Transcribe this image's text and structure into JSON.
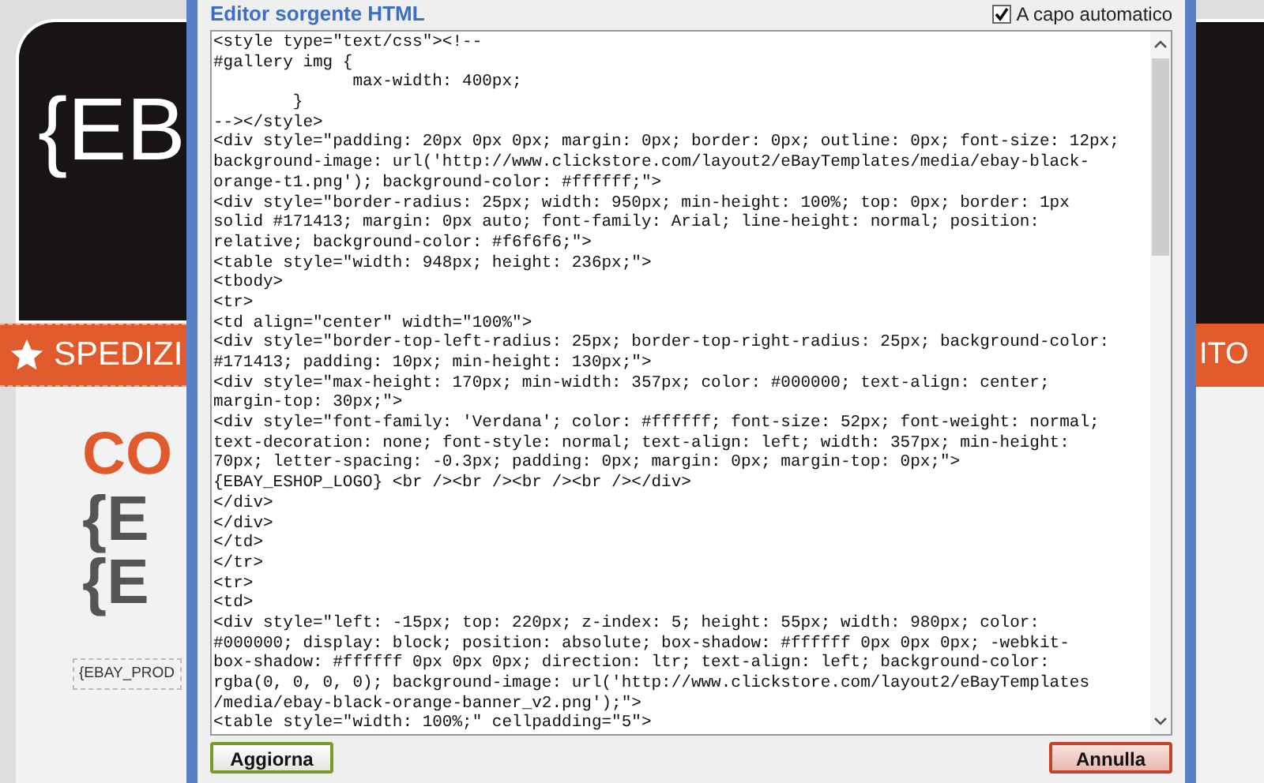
{
  "background_page": {
    "header_logo": "{EB",
    "banner_text": "SPEDIZI",
    "banner_text_right": "ITO",
    "heading": "CO",
    "title_lines": [
      "{E",
      "{E"
    ],
    "product_placeholder": "{EBAY_PROD"
  },
  "dialog": {
    "title": "Editor sorgente HTML",
    "word_wrap": {
      "label": "A capo automatico",
      "checked": true
    },
    "source_lines": [
      "<style type=\"text/css\"><!--",
      "#gallery img {",
      "              max-width: 400px;",
      "        }",
      "--></style>",
      "<div style=\"padding: 20px 0px 0px; margin: 0px; border: 0px; outline: 0px; font-size: 12px;",
      "background-image: url('http://www.clickstore.com/layout2/eBayTemplates/media/ebay-black-",
      "orange-t1.png'); background-color: #ffffff;\">",
      "<div style=\"border-radius: 25px; width: 950px; min-height: 100%; top: 0px; border: 1px",
      "solid #171413; margin: 0px auto; font-family: Arial; line-height: normal; position:",
      "relative; background-color: #f6f6f6;\">",
      "<table style=\"width: 948px; height: 236px;\">",
      "<tbody>",
      "<tr>",
      "<td align=\"center\" width=\"100%\">",
      "<div style=\"border-top-left-radius: 25px; border-top-right-radius: 25px; background-color:",
      "#171413; padding: 10px; min-height: 130px;\">",
      "<div style=\"max-height: 170px; min-width: 357px; color: #000000; text-align: center;",
      "margin-top: 30px;\">",
      "<div style=\"font-family: 'Verdana'; color: #ffffff; font-size: 52px; font-weight: normal;",
      "text-decoration: none; font-style: normal; text-align: left; width: 357px; min-height:",
      "70px; letter-spacing: -0.3px; padding: 0px; margin: 0px; margin-top: 0px;\">",
      "{EBAY_ESHOP_LOGO} <br /><br /><br /><br /></div>",
      "</div>",
      "</div>",
      "</td>",
      "</tr>",
      "<tr>",
      "<td>",
      "<div style=\"left: -15px; top: 220px; z-index: 5; height: 55px; width: 980px; color:",
      "#000000; display: block; position: absolute; box-shadow: #ffffff 0px 0px 0px; -webkit-",
      "box-shadow: #ffffff 0px 0px 0px; direction: ltr; text-align: left; background-color:",
      "rgba(0, 0, 0, 0); background-image: url('http://www.clickstore.com/layout2/eBayTemplates",
      "/media/ebay-black-orange-banner_v2.png');\">",
      "<table style=\"width: 100%;\" cellpadding=\"5\">"
    ],
    "buttons": [
      {
        "label": "Aggiorna",
        "kind": "confirm"
      },
      {
        "label": "Annulla",
        "kind": "cancel"
      }
    ]
  }
}
